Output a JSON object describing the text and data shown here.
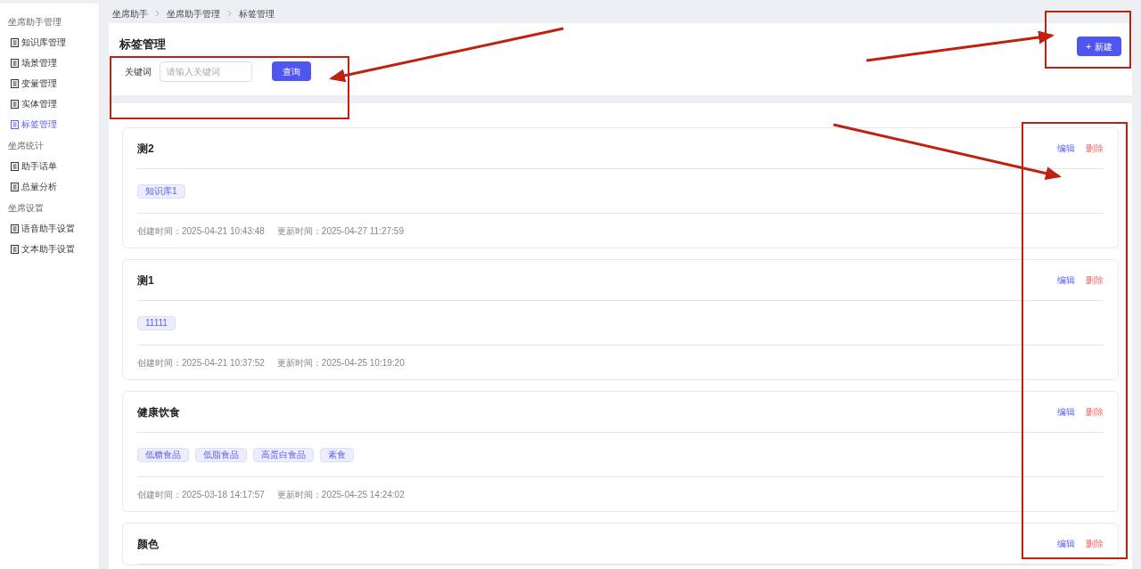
{
  "sidebar": {
    "groups": [
      {
        "title": "坐席助手管理",
        "items": [
          {
            "label": "知识库管理",
            "selected": false
          },
          {
            "label": "场景管理",
            "selected": false
          },
          {
            "label": "变量管理",
            "selected": false
          },
          {
            "label": "实体管理",
            "selected": false
          },
          {
            "label": "标签管理",
            "selected": true
          }
        ]
      },
      {
        "title": "坐席统计",
        "items": [
          {
            "label": "助手话单",
            "selected": false
          },
          {
            "label": "总量分析",
            "selected": false
          }
        ]
      },
      {
        "title": "坐席设置",
        "items": [
          {
            "label": "语音助手设置",
            "selected": false
          },
          {
            "label": "文本助手设置",
            "selected": false
          }
        ]
      }
    ]
  },
  "breadcrumb": [
    "坐席助手",
    "坐席助手管理",
    "标签管理"
  ],
  "page_title": "标签管理",
  "search": {
    "label": "关键词",
    "placeholder": "请输入关键词",
    "button": "查询"
  },
  "new_button": {
    "icon": "+",
    "label": "新建"
  },
  "cards": [
    {
      "title": "测2",
      "tags": [
        "知识库1"
      ],
      "created": "创建时间：2025-04-21 10:43:48",
      "updated": "更新时间：2025-04-27 11:27:59",
      "edit": "编辑",
      "delete": "删除"
    },
    {
      "title": "测1",
      "tags": [
        "11111"
      ],
      "created": "创建时间：2025-04-21 10:37:52",
      "updated": "更新时间：2025-04-25 10:19:20",
      "edit": "编辑",
      "delete": "删除"
    },
    {
      "title": "健康饮食",
      "tags": [
        "低糖食品",
        "低脂食品",
        "高蛋白食品",
        "素食"
      ],
      "created": "创建时间：2025-03-18 14:17:57",
      "updated": "更新时间：2025-04-25 14:24:02",
      "edit": "编辑",
      "delete": "删除"
    },
    {
      "title": "颜色",
      "edit": "编辑",
      "delete": "删除"
    }
  ]
}
